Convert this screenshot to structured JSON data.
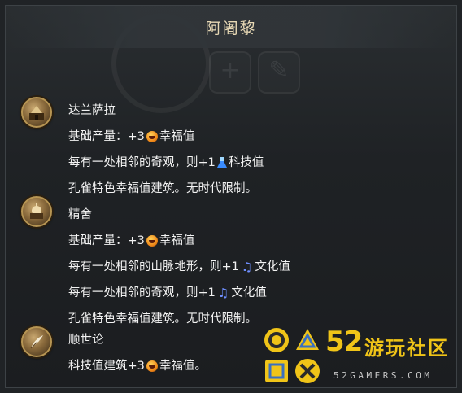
{
  "title": "阿阇黎",
  "colors": {
    "title": "#e8d9b5",
    "text": "#f2f2f2",
    "badge_border": "#b79553",
    "watermark": "#f0c418"
  },
  "sections": [
    {
      "name": "达兰萨拉",
      "icon": "temple-city-icon",
      "lines": [
        {
          "pre": "基础产量：+3",
          "icon": "amenity-icon",
          "post": "幸福值"
        },
        {
          "pre": "每有一处相邻的奇观，则+1",
          "icon": "science-icon",
          "post": "科技值"
        },
        {
          "pre": "孔雀特色幸福值建筑。无时代限制。",
          "icon": "",
          "post": ""
        }
      ]
    },
    {
      "name": "精舍",
      "icon": "monastery-icon",
      "lines": [
        {
          "pre": "基础产量：+3",
          "icon": "amenity-icon",
          "post": "幸福值"
        },
        {
          "pre": "每有一处相邻的山脉地形，则+1",
          "icon": "culture-icon",
          "post": "文化值"
        },
        {
          "pre": "每有一处相邻的奇观，则+1",
          "icon": "culture-icon",
          "post": "文化值"
        },
        {
          "pre": "孔雀特色幸福值建筑。无时代限制。",
          "icon": "",
          "post": ""
        }
      ]
    },
    {
      "name": "顺世论",
      "icon": "quill-icon",
      "lines": [
        {
          "pre": "科技值建筑+3",
          "icon": "amenity-icon",
          "post": "幸福值。"
        }
      ]
    }
  ],
  "watermark": {
    "number": "52",
    "text": "游玩社区",
    "url": "52GAMERS.COM"
  }
}
